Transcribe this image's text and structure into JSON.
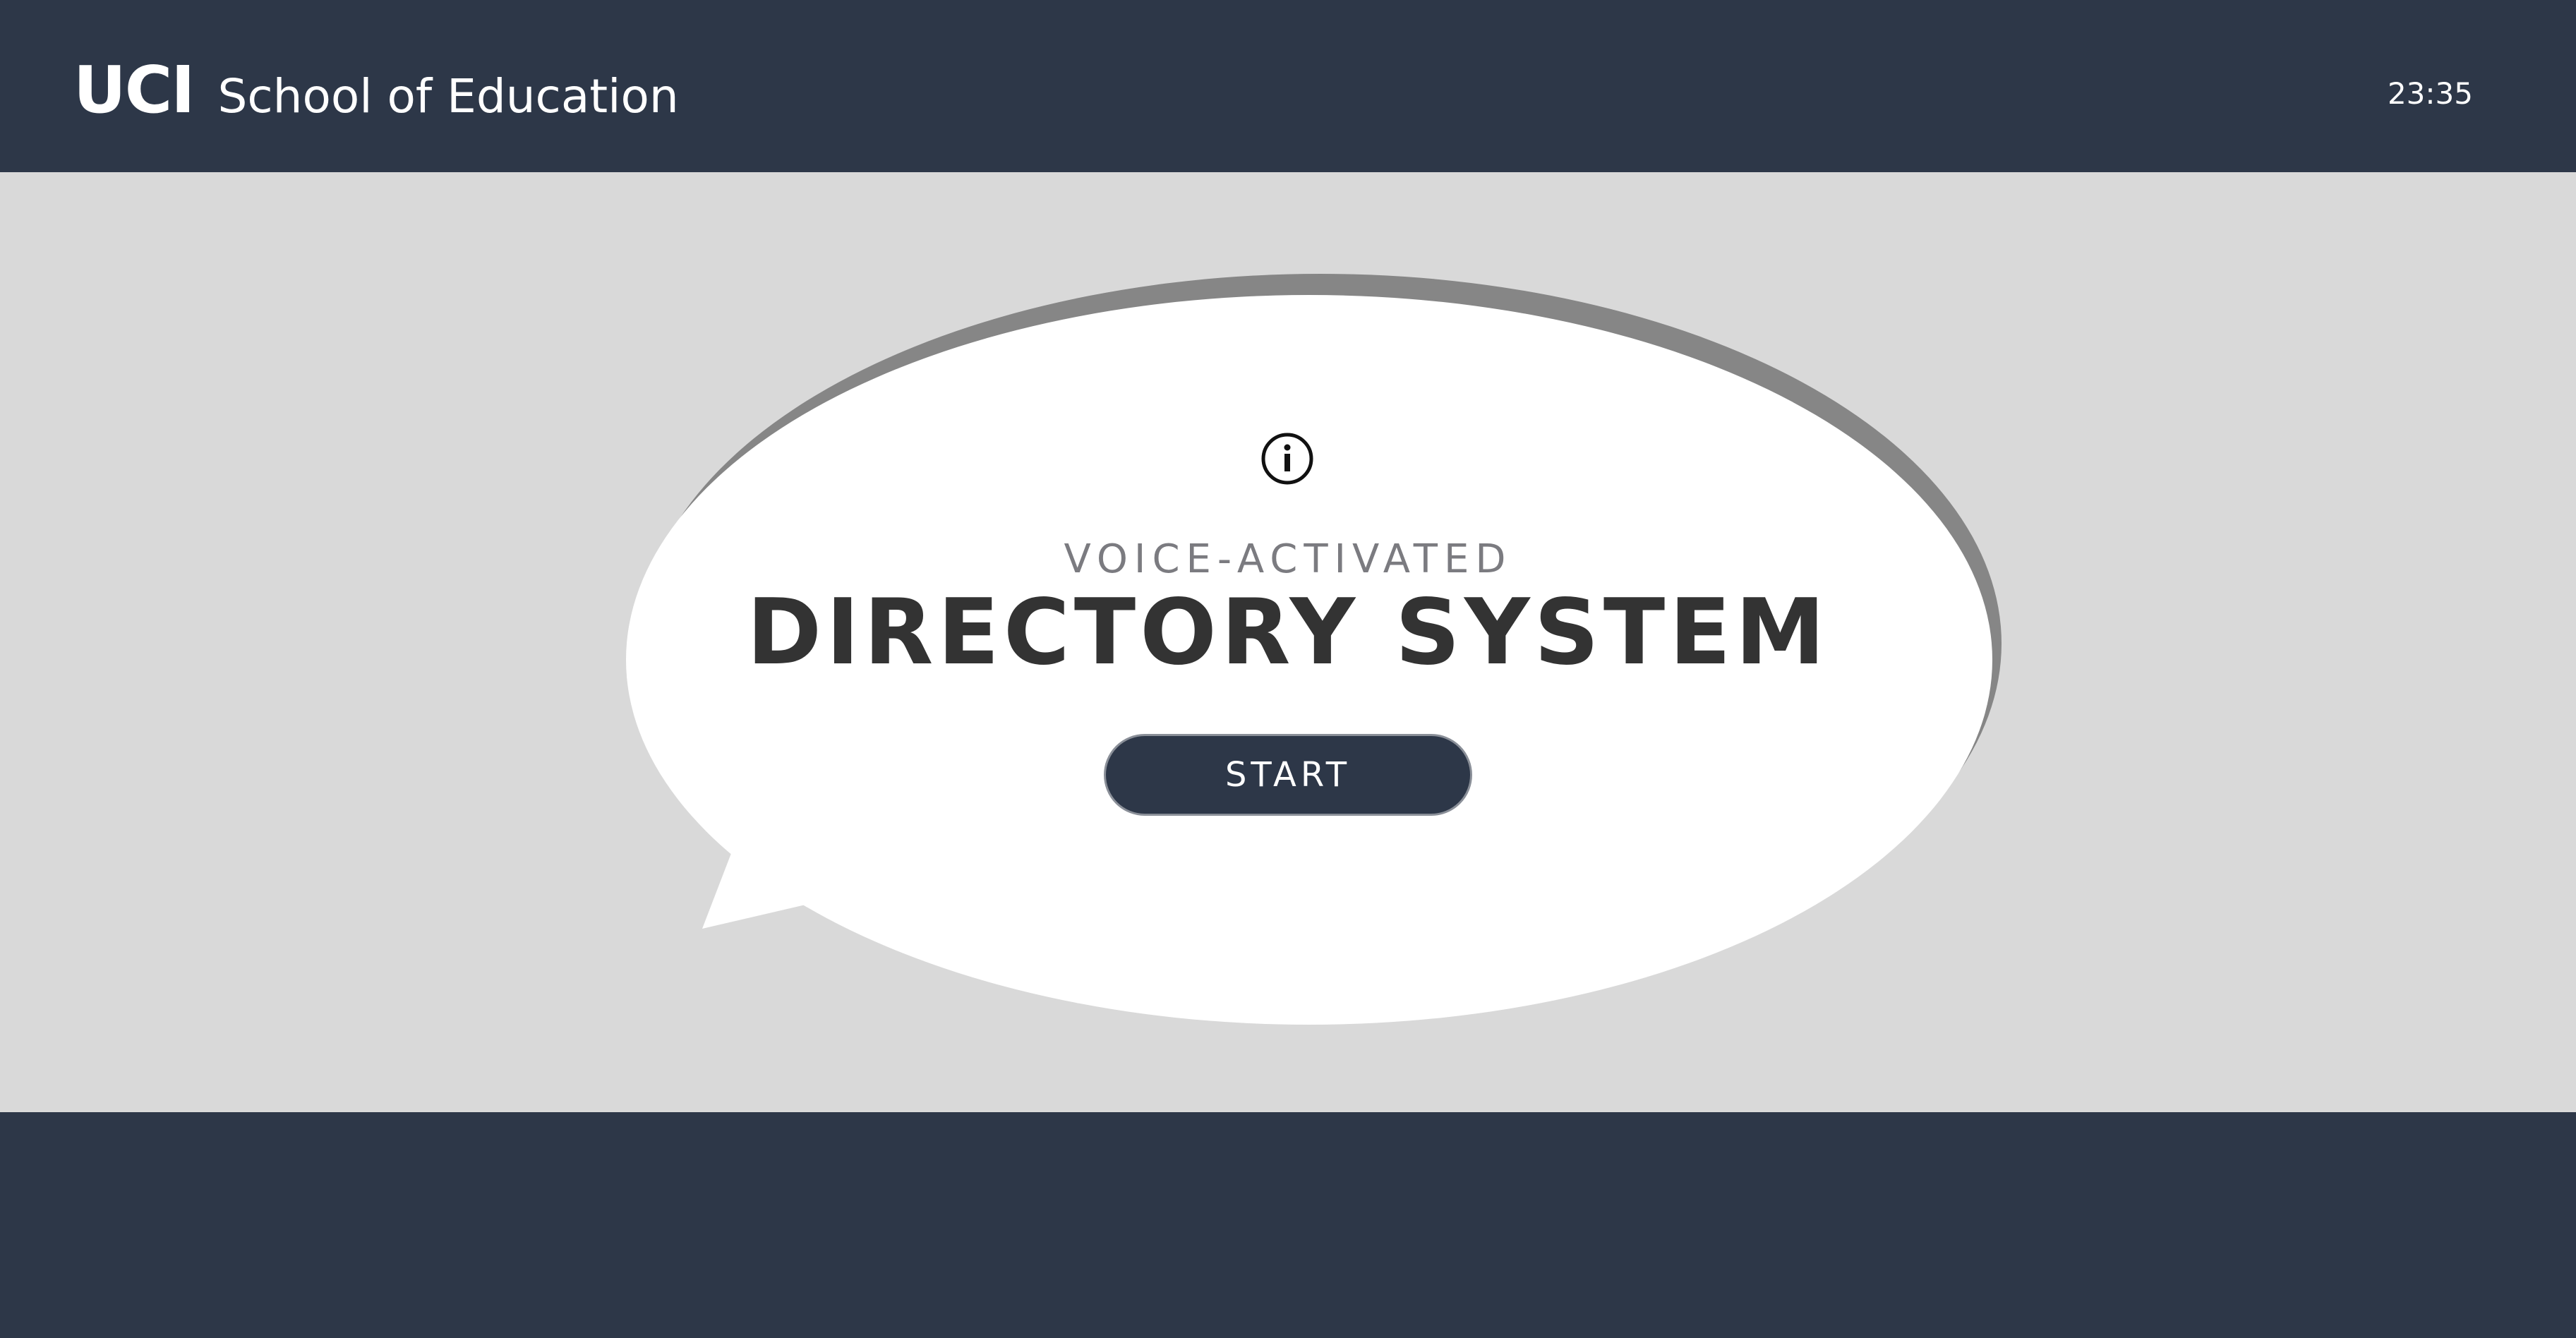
{
  "header": {
    "logo_mark": "UCI",
    "logo_text": "School of Education",
    "clock": "23:35"
  },
  "main": {
    "info_icon": "info-icon",
    "subtitle": "VOICE-ACTIVATED",
    "title": "DIRECTORY SYSTEM",
    "start_label": "START"
  },
  "colors": {
    "header_bg": "#2d3748",
    "main_bg": "#d9d9d9",
    "bubble_fill": "#ffffff",
    "bubble_shadow": "#868686",
    "title_text": "#333333",
    "subtitle_text": "#7b7b80",
    "button_bg": "#2d3748"
  }
}
